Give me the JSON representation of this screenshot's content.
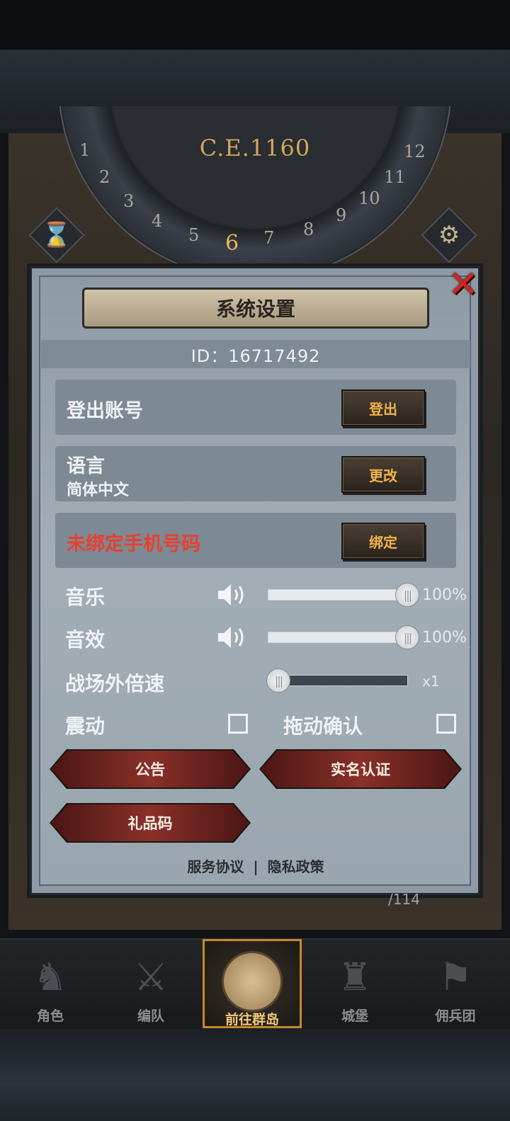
{
  "header": {
    "era": "C.E.1160",
    "dial_numbers": [
      "1",
      "2",
      "3",
      "4",
      "5",
      "6",
      "7",
      "8",
      "9",
      "10",
      "11",
      "12"
    ],
    "current_month": "6"
  },
  "dialog": {
    "title": "系统设置",
    "id_text": "ID：16717492",
    "close_icon": "close-icon",
    "logout": {
      "label": "登出账号",
      "button": "登出"
    },
    "language": {
      "label": "语言",
      "value": "简体中文",
      "button": "更改"
    },
    "phone": {
      "label": "未绑定手机号码",
      "button": "绑定",
      "label_color": "#e8402e"
    },
    "music": {
      "label": "音乐",
      "value_text": "100%",
      "level": 1.0
    },
    "sfx": {
      "label": "音效",
      "value_text": "100%",
      "level": 1.0
    },
    "speed": {
      "label": "战场外倍速",
      "value_text": "x1",
      "level": 0.0
    },
    "vibration": {
      "label": "震动",
      "checked": false
    },
    "drag_confirm": {
      "label": "拖动确认",
      "checked": false
    },
    "buttons": {
      "notice": "公告",
      "realname": "实名认证",
      "gift": "礼品码"
    },
    "footer": {
      "terms": "服务协议",
      "separator": "|",
      "privacy": "隐私政策"
    }
  },
  "nav": {
    "items": [
      {
        "label": "角色",
        "icon": "knight-helmet-icon"
      },
      {
        "label": "编队",
        "icon": "squad-icon"
      },
      {
        "label": "前往群岛",
        "icon": "globe-icon",
        "active": true
      },
      {
        "label": "城堡",
        "icon": "castle-icon"
      },
      {
        "label": "佣兵团",
        "icon": "mercenary-icon"
      }
    ]
  },
  "map_overlay": {
    "count_text": "/114"
  },
  "colors": {
    "accent_gold": "#f2b24a",
    "warning_red": "#e8402e",
    "active_border": "#c8892a"
  }
}
